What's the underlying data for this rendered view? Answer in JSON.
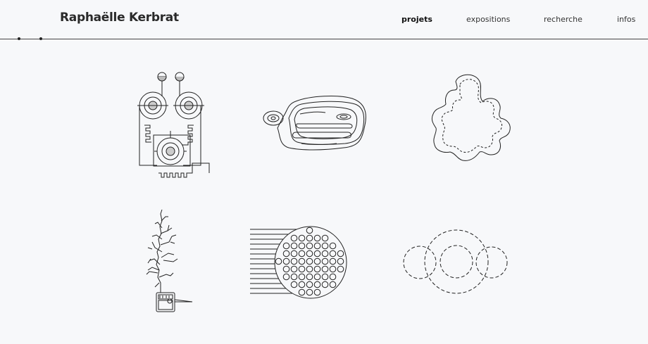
{
  "site": {
    "title": "Raphaëlle Kerbrat"
  },
  "nav": {
    "items": [
      "projets",
      "expositions",
      "recherche",
      "infos"
    ],
    "active": "projets"
  },
  "projects": [
    {
      "icon": "circuit-icon"
    },
    {
      "icon": "contour-map-icon"
    },
    {
      "icon": "leaf-icon"
    },
    {
      "icon": "branching-sensor-icon"
    },
    {
      "icon": "dot-sphere-icon"
    },
    {
      "icon": "dashed-circles-icon"
    }
  ]
}
